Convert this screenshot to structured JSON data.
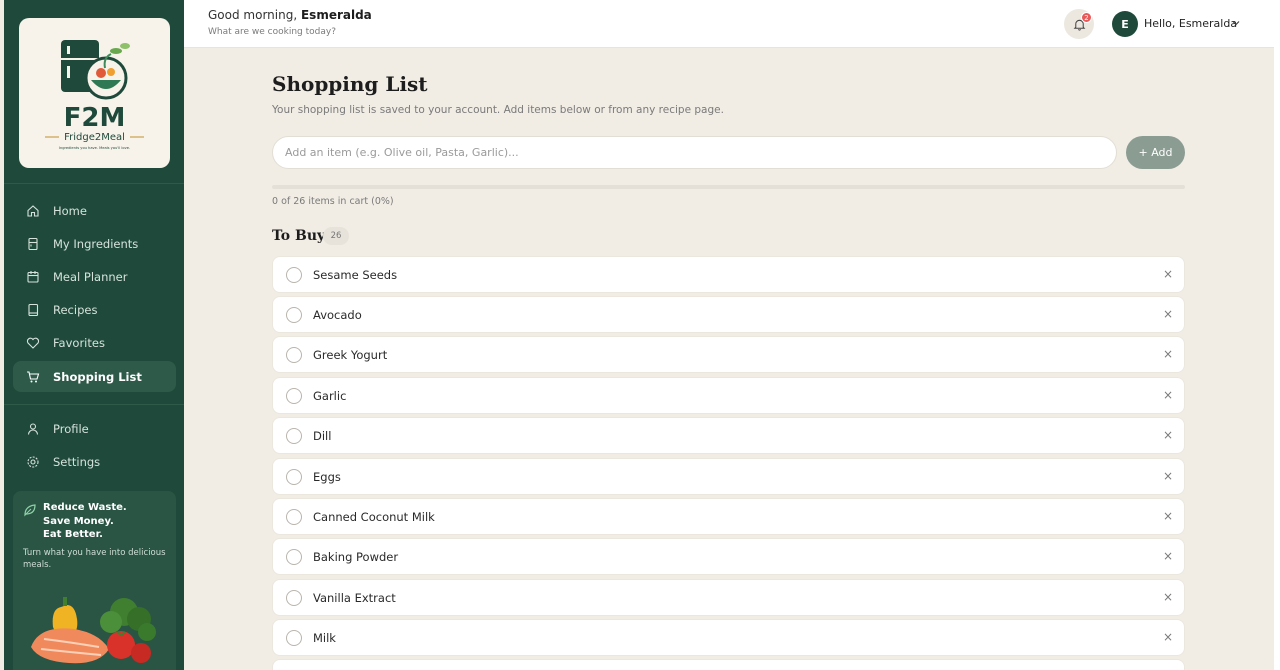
{
  "brand": {
    "logo_text": "F2M",
    "logo_name": "Fridge2Meal",
    "logo_tagline": "Ingredients you have. Meals you'll love."
  },
  "sidebar": {
    "items": [
      {
        "label": "Home",
        "icon": "home-icon"
      },
      {
        "label": "My Ingredients",
        "icon": "fridge-icon"
      },
      {
        "label": "Meal Planner",
        "icon": "calendar-icon"
      },
      {
        "label": "Recipes",
        "icon": "book-icon"
      },
      {
        "label": "Favorites",
        "icon": "heart-icon"
      },
      {
        "label": "Shopping List",
        "icon": "cart-icon",
        "active": true
      }
    ],
    "secondary": [
      {
        "label": "Profile",
        "icon": "user-icon"
      },
      {
        "label": "Settings",
        "icon": "gear-icon"
      }
    ],
    "promo": {
      "title_line1": "Reduce Waste.",
      "title_line2": "Save Money.",
      "title_line3": "Eat Better.",
      "subtitle": "Turn what you have into delicious meals."
    }
  },
  "header": {
    "greeting": "Good morning,",
    "greeting_name": "Esmeralda",
    "subtitle": "What are we cooking today?",
    "notification_count": "2",
    "avatar_initial": "E",
    "user_label": "Hello, Esmeralda"
  },
  "main": {
    "title": "Shopping List",
    "subtitle": "Your shopping list is saved to your account. Add items below or from any recipe page.",
    "input_placeholder": "Add an item (e.g. Olive oil, Pasta, Garlic)...",
    "add_button": "+ Add",
    "progress_text": "0 of 26 items in cart (0%)",
    "progress_fraction": 0,
    "section_title": "To Buy",
    "section_count": "26",
    "remove_glyph": "×",
    "items": [
      "Sesame Seeds",
      "Avocado",
      "Greek Yogurt",
      "Garlic",
      "Dill",
      "Eggs",
      "Canned Coconut Milk",
      "Baking Powder",
      "Vanilla Extract",
      "Milk"
    ]
  },
  "colors": {
    "sidebar_bg": "#1f4a3b",
    "page_bg": "#f1ede5",
    "accent": "#1f4a3b",
    "badge": "#e85a5a",
    "add_button": "#8b9c92"
  }
}
